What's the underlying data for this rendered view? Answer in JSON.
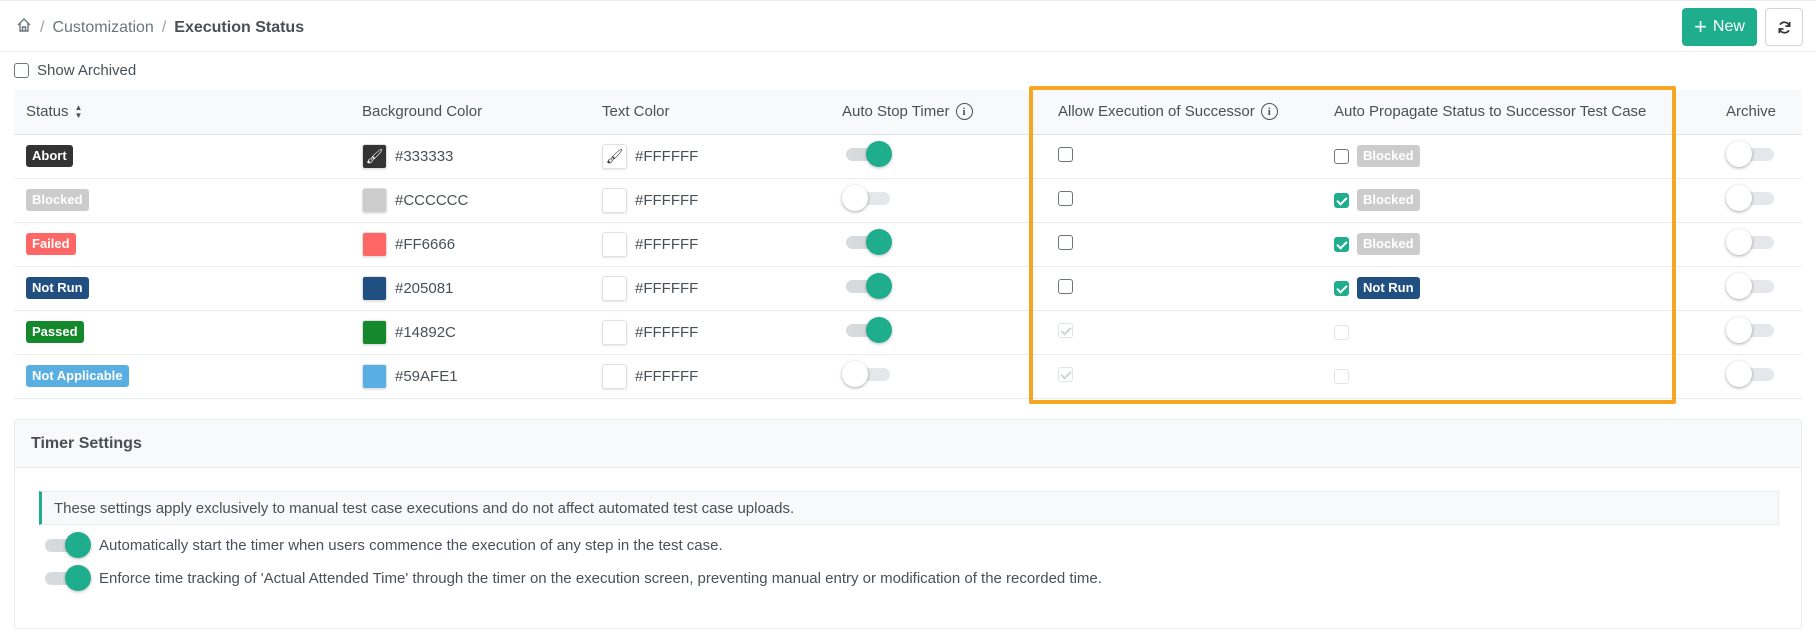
{
  "breadcrumb": {
    "items": [
      "Customization",
      "Execution Status"
    ],
    "separator": "/"
  },
  "toolbar": {
    "new_label": "New",
    "accent": "#1fae8d"
  },
  "filter": {
    "show_archived_label": "Show Archived",
    "show_archived_checked": false
  },
  "table": {
    "headers": {
      "status": "Status",
      "background_color": "Background Color",
      "text_color": "Text Color",
      "auto_stop_timer": "Auto Stop Timer",
      "allow_execution": "Allow Execution of Successor",
      "auto_propagate": "Auto Propagate Status to Successor Test Case",
      "archive": "Archive"
    },
    "rows": [
      {
        "status": "Abort",
        "bg": "#333333",
        "text": "#FFFFFF",
        "auto_stop": true,
        "allow_exec": false,
        "allow_exec_disabled": false,
        "propagate": false,
        "propagate_disabled": false,
        "propagate_status": "Blocked",
        "propagate_bg": "#CCCCCC",
        "archived": false
      },
      {
        "status": "Blocked",
        "bg": "#CCCCCC",
        "text": "#FFFFFF",
        "auto_stop": false,
        "allow_exec": false,
        "allow_exec_disabled": false,
        "propagate": true,
        "propagate_disabled": false,
        "propagate_status": "Blocked",
        "propagate_bg": "#CCCCCC",
        "archived": false
      },
      {
        "status": "Failed",
        "bg": "#FF6666",
        "text": "#FFFFFF",
        "auto_stop": true,
        "allow_exec": false,
        "allow_exec_disabled": false,
        "propagate": true,
        "propagate_disabled": false,
        "propagate_status": "Blocked",
        "propagate_bg": "#CCCCCC",
        "archived": false
      },
      {
        "status": "Not Run",
        "bg": "#205081",
        "text": "#FFFFFF",
        "auto_stop": true,
        "allow_exec": false,
        "allow_exec_disabled": false,
        "propagate": true,
        "propagate_disabled": false,
        "propagate_status": "Not Run",
        "propagate_bg": "#205081",
        "archived": false
      },
      {
        "status": "Passed",
        "bg": "#14892C",
        "text": "#FFFFFF",
        "auto_stop": true,
        "allow_exec": true,
        "allow_exec_disabled": true,
        "propagate": false,
        "propagate_disabled": true,
        "propagate_status": "",
        "propagate_bg": "",
        "archived": false
      },
      {
        "status": "Not Applicable",
        "bg": "#59AFE1",
        "text": "#FFFFFF",
        "auto_stop": false,
        "allow_exec": true,
        "allow_exec_disabled": true,
        "propagate": false,
        "propagate_disabled": true,
        "propagate_status": "",
        "propagate_bg": "",
        "archived": false
      }
    ]
  },
  "timer": {
    "title": "Timer Settings",
    "note": "These settings apply exclusively to manual test case executions and do not affect automated test case uploads.",
    "options": [
      {
        "label": "Automatically start the timer when users commence the execution of any step in the test case.",
        "enabled": true
      },
      {
        "label": "Enforce time tracking of 'Actual Attended Time' through the timer on the execution screen, preventing manual entry or modification of the recorded time.",
        "enabled": true
      }
    ]
  },
  "highlight_color": "#f5a623"
}
